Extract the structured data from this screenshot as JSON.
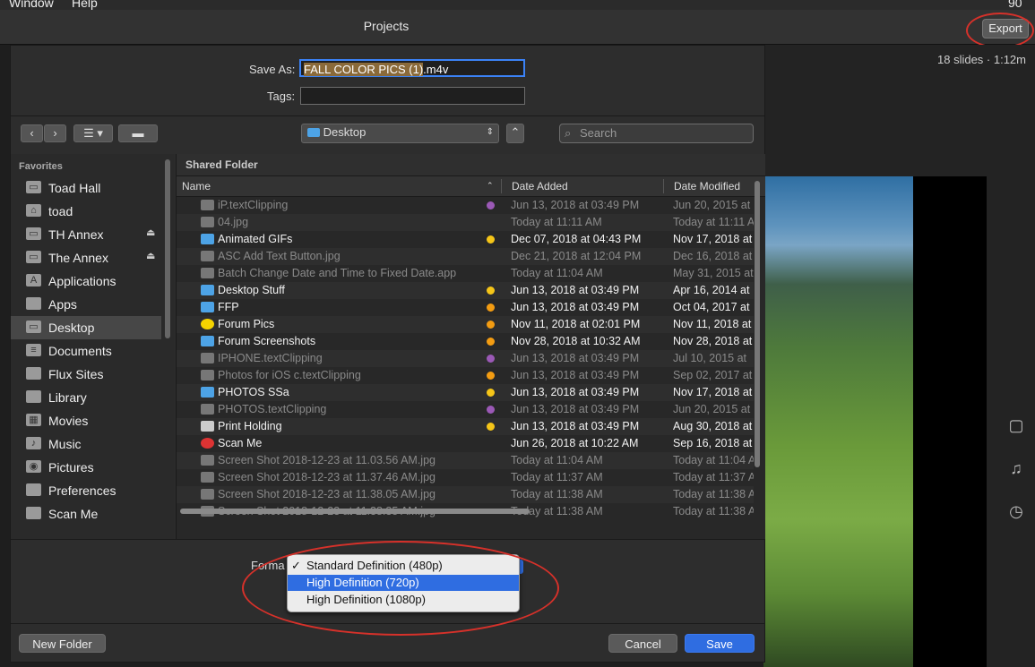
{
  "menubar": {
    "items": [
      "Window",
      "Help"
    ],
    "right_text": "90"
  },
  "app": {
    "title": "Projects",
    "export_label": "Export",
    "slides_info": "18 slides · 1:12m"
  },
  "dialog": {
    "save_as_label": "Save As:",
    "save_as_selected": "FALL COLOR PICS (1)",
    "save_as_ext": ".m4v",
    "tags_label": "Tags:",
    "tags_value": "",
    "location": "Desktop",
    "search_placeholder": "Search",
    "sidebar": {
      "heading": "Favorites",
      "items": [
        {
          "label": "Toad Hall",
          "icon": "disk-icon",
          "eject": false
        },
        {
          "label": "toad",
          "icon": "home-icon",
          "eject": false
        },
        {
          "label": "TH Annex",
          "icon": "disk-icon",
          "eject": true
        },
        {
          "label": "The Annex",
          "icon": "disk-icon",
          "eject": true
        },
        {
          "label": "Applications",
          "icon": "applications-icon",
          "eject": false
        },
        {
          "label": "Apps",
          "icon": "folder-icon",
          "eject": false
        },
        {
          "label": "Desktop",
          "icon": "desktop-icon",
          "eject": false,
          "selected": true
        },
        {
          "label": "Documents",
          "icon": "documents-icon",
          "eject": false
        },
        {
          "label": "Flux Sites",
          "icon": "folder-icon",
          "eject": false
        },
        {
          "label": "Library",
          "icon": "folder-icon",
          "eject": false
        },
        {
          "label": "Movies",
          "icon": "movies-icon",
          "eject": false
        },
        {
          "label": "Music",
          "icon": "music-icon",
          "eject": false
        },
        {
          "label": "Pictures",
          "icon": "pictures-icon",
          "eject": false
        },
        {
          "label": "Preferences",
          "icon": "folder-icon",
          "eject": false
        },
        {
          "label": "Scan Me",
          "icon": "folder-icon",
          "eject": false
        }
      ]
    },
    "shared_folder_label": "Shared Folder",
    "columns": [
      "Name",
      "Date Added",
      "Date Modified"
    ],
    "files": [
      {
        "name": "iP.textClipping",
        "added": "Jun 13, 2018 at 03:49 PM",
        "modified": "Jun 20, 2015 at",
        "tag": "#9b59b6",
        "dim": true,
        "kind": "file"
      },
      {
        "name": "04.jpg",
        "added": "Today at 11:11 AM",
        "modified": "Today at 11:11 A",
        "tag": "",
        "dim": true,
        "kind": "file"
      },
      {
        "name": "Animated GIFs",
        "added": "Dec 07, 2018 at 04:43 PM",
        "modified": "Nov 17, 2018 at",
        "tag": "#f5c518",
        "dim": false,
        "kind": "folder"
      },
      {
        "name": "ASC Add Text Button.jpg",
        "added": "Dec 21, 2018 at 12:04 PM",
        "modified": "Dec 16, 2018 at",
        "tag": "",
        "dim": true,
        "kind": "file"
      },
      {
        "name": "Batch Change Date and Time to Fixed Date.app",
        "added": "Today at 11:04 AM",
        "modified": "May 31, 2015 at",
        "tag": "",
        "dim": true,
        "kind": "file"
      },
      {
        "name": "Desktop Stuff",
        "added": "Jun 13, 2018 at 03:49 PM",
        "modified": "Apr 16, 2014 at",
        "tag": "#f5c518",
        "dim": false,
        "kind": "folder"
      },
      {
        "name": "FFP",
        "added": "Jun 13, 2018 at 03:49 PM",
        "modified": "Oct 04, 2017 at",
        "tag": "#f39c12",
        "dim": false,
        "kind": "folder"
      },
      {
        "name": "Forum Pics",
        "added": "Nov 11, 2018 at 02:01 PM",
        "modified": "Nov 11, 2018 at",
        "tag": "#f39c12",
        "dim": false,
        "kind": "yellow"
      },
      {
        "name": "Forum Screenshots",
        "added": "Nov 28, 2018 at 10:32 AM",
        "modified": "Nov 28, 2018 at",
        "tag": "#f39c12",
        "dim": false,
        "kind": "folder"
      },
      {
        "name": "IPHONE.textClipping",
        "added": "Jun 13, 2018 at 03:49 PM",
        "modified": "Jul 10, 2015 at",
        "tag": "#9b59b6",
        "dim": true,
        "kind": "file"
      },
      {
        "name": "Photos for iOS c.textClipping",
        "added": "Jun 13, 2018 at 03:49 PM",
        "modified": "Sep 02, 2017 at",
        "tag": "#f39c12",
        "dim": true,
        "kind": "file"
      },
      {
        "name": "PHOTOS SSa",
        "added": "Jun 13, 2018 at 03:49 PM",
        "modified": "Nov 17, 2018 at",
        "tag": "#f5c518",
        "dim": false,
        "kind": "folder"
      },
      {
        "name": "PHOTOS.textClipping",
        "added": "Jun 13, 2018 at 03:49 PM",
        "modified": "Jun 20, 2015 at",
        "tag": "#9b59b6",
        "dim": true,
        "kind": "file"
      },
      {
        "name": "Print Holding",
        "added": "Jun 13, 2018 at 03:49 PM",
        "modified": "Aug 30, 2018 at",
        "tag": "#f5c518",
        "dim": false,
        "kind": "printer"
      },
      {
        "name": "Scan Me",
        "added": "Jun 26, 2018 at 10:22 AM",
        "modified": "Sep 16, 2018 at",
        "tag": "",
        "dim": false,
        "kind": "red"
      },
      {
        "name": "Screen Shot 2018-12-23 at 11.03.56 AM.jpg",
        "added": "Today at 11:04 AM",
        "modified": "Today at 11:04 A",
        "tag": "",
        "dim": true,
        "kind": "file"
      },
      {
        "name": "Screen Shot 2018-12-23 at 11.37.46 AM.jpg",
        "added": "Today at 11:37 AM",
        "modified": "Today at 11:37 A",
        "tag": "",
        "dim": true,
        "kind": "file"
      },
      {
        "name": "Screen Shot 2018-12-23 at 11.38.05 AM.jpg",
        "added": "Today at 11:38 AM",
        "modified": "Today at 11:38 A",
        "tag": "",
        "dim": true,
        "kind": "file"
      },
      {
        "name": "Screen Shot 2018-12-23 at 11.38.35 AM.jpg",
        "added": "Today at 11:38 AM",
        "modified": "Today at 11:38 A",
        "tag": "",
        "dim": true,
        "kind": "file"
      }
    ],
    "format_label": "Forma",
    "format_options": [
      {
        "label": "Standard Definition (480p)",
        "checked": true,
        "highlighted": false
      },
      {
        "label": "High Definition (720p)",
        "checked": false,
        "highlighted": true
      },
      {
        "label": "High Definition (1080p)",
        "checked": false,
        "highlighted": false
      }
    ],
    "new_folder_label": "New Folder",
    "cancel_label": "Cancel",
    "save_label": "Save"
  },
  "colors": {
    "accent": "#2f6de1",
    "annotation": "#d6312a"
  }
}
